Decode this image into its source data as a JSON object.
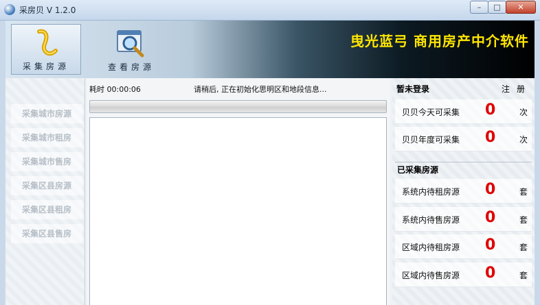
{
  "window": {
    "title": "采房贝 V 1.2.0",
    "minimize": "–",
    "maximize": "□",
    "close": "✕"
  },
  "toolbar": {
    "collect_label": "采集房源",
    "view_label": "查看房源",
    "banner": "曳光蓝弓  商用房产中介软件"
  },
  "leftnav": {
    "items": [
      {
        "label": "采集城市房源"
      },
      {
        "label": "采集城市租房"
      },
      {
        "label": "采集城市售房"
      },
      {
        "label": "采集区县房源"
      },
      {
        "label": "采集区县租房"
      },
      {
        "label": "采集区县售房"
      }
    ]
  },
  "center": {
    "elapsed": "耗时 00:00:06",
    "status": "请稍后, 正在初始化思明区和地段信息..."
  },
  "right": {
    "login_title": "暂未登录",
    "register": "注册",
    "quota": [
      {
        "label": "贝贝今天可采集",
        "value": "0",
        "unit": "次"
      },
      {
        "label": "贝贝年度可采集",
        "value": "0",
        "unit": "次"
      }
    ],
    "collected_title": "已采集房源",
    "collected": [
      {
        "label": "系统内待租房源",
        "value": "0",
        "unit": "套"
      },
      {
        "label": "系统内待售房源",
        "value": "0",
        "unit": "套"
      },
      {
        "label": "区域内待租房源",
        "value": "0",
        "unit": "套"
      },
      {
        "label": "区域内待售房源",
        "value": "0",
        "unit": "套"
      }
    ]
  },
  "colors": {
    "banner_text": "#ffe600",
    "counter_red": "#e00000"
  }
}
